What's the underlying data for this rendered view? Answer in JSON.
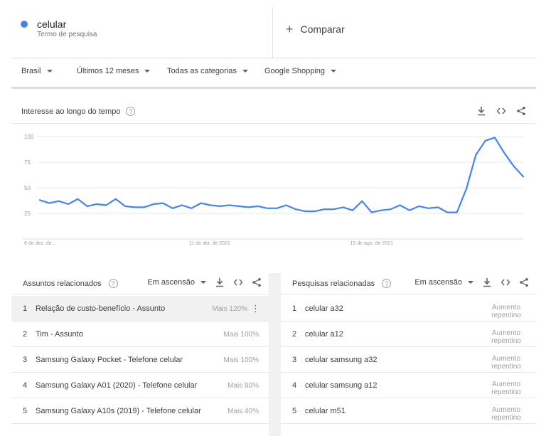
{
  "term": {
    "name": "celular",
    "subtitle": "Termo de pesquisa",
    "color": "#4285f4"
  },
  "compare": {
    "label": "Comparar"
  },
  "filters": [
    "Brasil",
    "Últimos 12 meses",
    "Todas as categorias",
    "Google Shopping"
  ],
  "interest": {
    "title": "Interesse ao longo do tempo"
  },
  "chart_data": {
    "type": "line",
    "y_ticks": [
      100,
      75,
      50,
      25
    ],
    "ylim": [
      0,
      100
    ],
    "x_tick_labels": [
      "6 de dez. de...",
      "11 de abr. de 2021",
      "15 de ago. de 2021"
    ],
    "x_tick_indices": [
      0,
      18,
      35
    ],
    "values": [
      38,
      35,
      37,
      34,
      39,
      32,
      34,
      33,
      39,
      32,
      31,
      31,
      34,
      35,
      30,
      33,
      30,
      35,
      33,
      32,
      33,
      32,
      31,
      32,
      30,
      30,
      33,
      29,
      27,
      27,
      29,
      29,
      31,
      28,
      37,
      26,
      28,
      29,
      33,
      28,
      32,
      30,
      31,
      26,
      26,
      49,
      82,
      96,
      99,
      84,
      71,
      61
    ],
    "color": "#4285f4",
    "grid": true
  },
  "topics": {
    "title": "Assuntos relacionados",
    "mode": "Em ascensão",
    "items": [
      {
        "rank": "1",
        "label": "Relação de custo-benefício - Assunto",
        "value": "Mais 120%"
      },
      {
        "rank": "2",
        "label": "Tim - Assunto",
        "value": "Mais 100%"
      },
      {
        "rank": "3",
        "label": "Samsung Galaxy Pocket - Telefone celular",
        "value": "Mais 100%"
      },
      {
        "rank": "4",
        "label": "Samsung Galaxy A01 (2020) - Telefone celular",
        "value": "Mais 80%"
      },
      {
        "rank": "5",
        "label": "Samsung Galaxy A10s (2019) - Telefone celular",
        "value": "Mais 40%"
      }
    ]
  },
  "queries": {
    "title": "Pesquisas relacionadas",
    "mode": "Em ascensão",
    "items": [
      {
        "rank": "1",
        "label": "celular a32",
        "value_line1": "Aumento",
        "value_line2": "repentino"
      },
      {
        "rank": "2",
        "label": "celular a12",
        "value_line1": "Aumento",
        "value_line2": "repentino"
      },
      {
        "rank": "3",
        "label": "celular samsung a32",
        "value_line1": "Aumento",
        "value_line2": "repentino"
      },
      {
        "rank": "4",
        "label": "celular samsung a12",
        "value_line1": "Aumento",
        "value_line2": "repentino"
      },
      {
        "rank": "5",
        "label": "celular m51",
        "value_line1": "Aumento",
        "value_line2": "repentino"
      }
    ]
  }
}
